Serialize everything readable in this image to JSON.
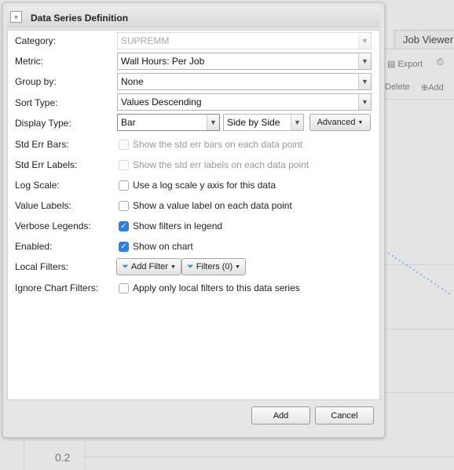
{
  "background": {
    "tab": "Job Viewer",
    "export": "Export",
    "delete": "Delete",
    "add": "Add",
    "axis_tick": "0.2",
    "series_color": "#6aaee8"
  },
  "dialog": {
    "title": "Data Series Definition",
    "fields": {
      "category": {
        "label": "Category:",
        "value": "SUPREMM",
        "disabled": true
      },
      "metric": {
        "label": "Metric:",
        "value": "Wall Hours: Per Job"
      },
      "group_by": {
        "label": "Group by:",
        "value": "None"
      },
      "sort_type": {
        "label": "Sort Type:",
        "value": "Values Descending"
      },
      "display_type": {
        "label": "Display Type:",
        "value": "Bar",
        "combine": "Side by Side",
        "advanced": "Advanced"
      },
      "std_err_bars": {
        "label": "Std Err Bars:",
        "text": "Show the std err bars on each data point",
        "checked": false,
        "disabled": true
      },
      "std_err_labels": {
        "label": "Std Err Labels:",
        "text": "Show the std err labels on each data point",
        "checked": false,
        "disabled": true
      },
      "log_scale": {
        "label": "Log Scale:",
        "text": "Use a log scale y axis for this data",
        "checked": false
      },
      "value_labels": {
        "label": "Value Labels:",
        "text": "Show a value label on each data point",
        "checked": false
      },
      "verbose_legends": {
        "label": "Verbose Legends:",
        "text": "Show filters in legend",
        "checked": true
      },
      "enabled": {
        "label": "Enabled:",
        "text": "Show on chart",
        "checked": true
      },
      "local_filters": {
        "label": "Local Filters:",
        "add_filter": "Add Filter",
        "filters": "Filters (0)"
      },
      "ignore_chart_filters": {
        "label": "Ignore Chart Filters:",
        "text": "Apply only local filters to this data series",
        "checked": false
      }
    },
    "buttons": {
      "add": "Add",
      "cancel": "Cancel"
    }
  }
}
